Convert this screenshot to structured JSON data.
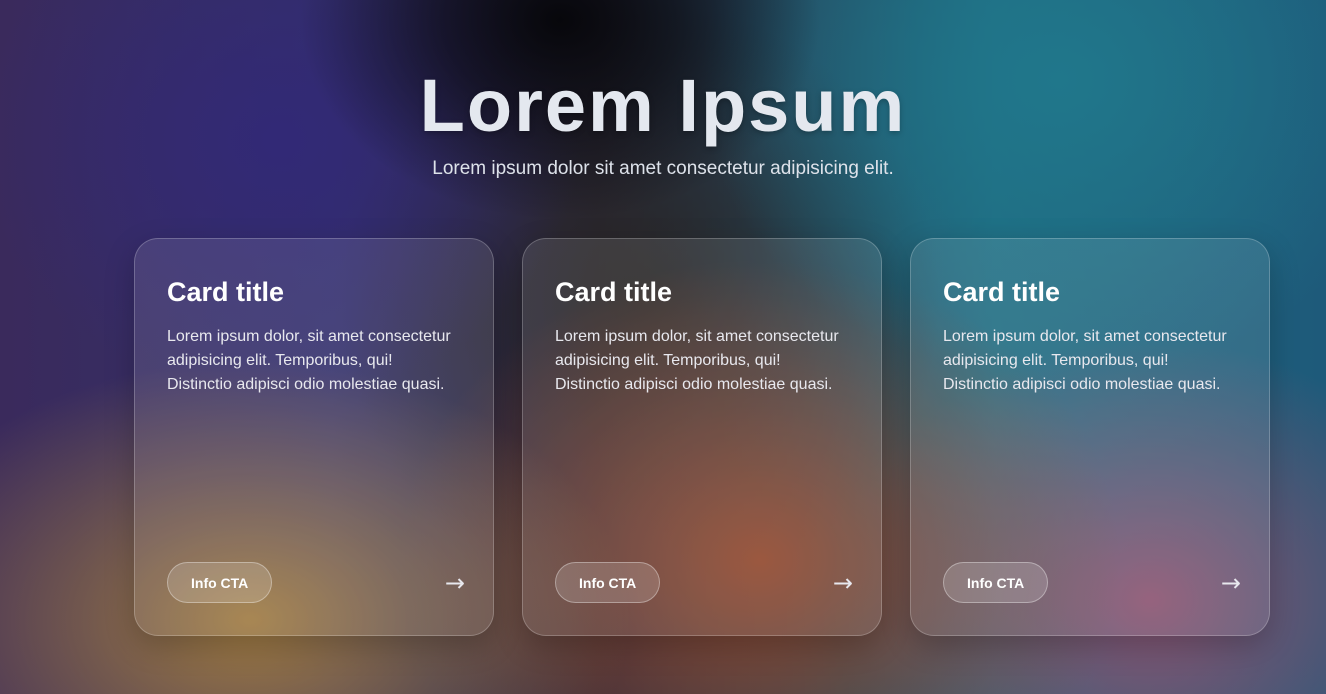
{
  "hero": {
    "title": "Lorem Ipsum",
    "subtitle": "Lorem ipsum dolor sit amet consectetur adipisicing elit."
  },
  "cards": [
    {
      "title": "Card title",
      "text": "Lorem ipsum dolor, sit amet consectetur adipisicing elit. Temporibus, qui! Distinctio adipisci odio molestiae quasi.",
      "cta_label": "Info CTA",
      "arrow": "→",
      "arrow_icon": "arrow-right-icon"
    },
    {
      "title": "Card title",
      "text": "Lorem ipsum dolor, sit amet consectetur adipisicing elit. Temporibus, qui! Distinctio adipisci odio molestiae quasi.",
      "cta_label": "Info CTA",
      "arrow": "→",
      "arrow_icon": "arrow-right-icon"
    },
    {
      "title": "Card title",
      "text": "Lorem ipsum dolor, sit amet consectetur adipisicing elit. Temporibus, qui! Distinctio adipisci odio molestiae quasi.",
      "cta_label": "Info CTA",
      "arrow": "→",
      "arrow_icon": "arrow-right-icon"
    }
  ]
}
